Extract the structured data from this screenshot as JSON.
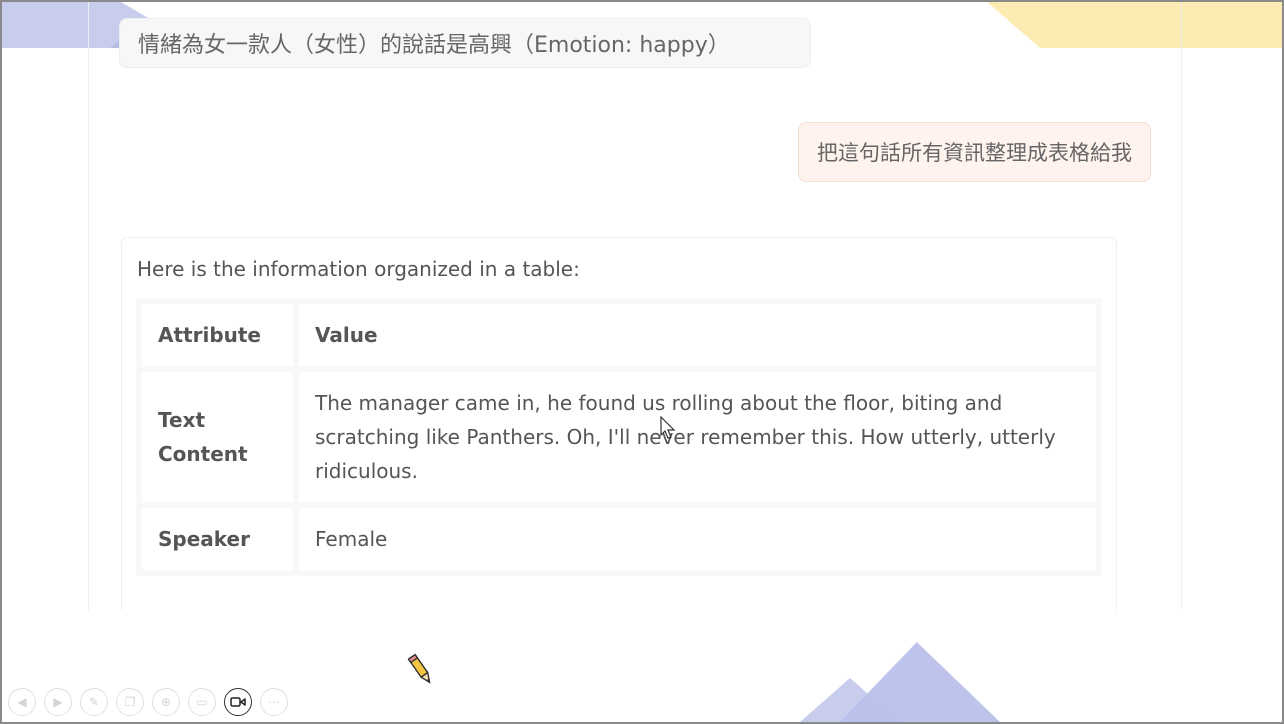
{
  "chat": {
    "previous_message_fragment": "情緒為女一款人（女性）的說話是高興（Emotion: happy）",
    "user_message": "把這句話所有資訊整理成表格給我",
    "assistant": {
      "intro": "Here is the information organized in a table:",
      "table": {
        "header": {
          "key": "Attribute",
          "value": "Value"
        },
        "rows": [
          {
            "key": "Text Content",
            "value": "The manager came in, he found us rolling about the floor, biting and scratching like Panthers. Oh, I'll never remember this. How utterly, utterly ridiculous."
          },
          {
            "key": "Speaker",
            "value": "Female"
          }
        ]
      }
    }
  },
  "toolbar": {
    "buttons": [
      {
        "name": "prev-slide-button",
        "icon": "arrow-left-icon",
        "glyph": "◀"
      },
      {
        "name": "next-slide-button",
        "icon": "arrow-right-icon",
        "glyph": "▶"
      },
      {
        "name": "pen-button",
        "icon": "pen-icon",
        "glyph": "✎"
      },
      {
        "name": "slides-button",
        "icon": "slides-icon",
        "glyph": "❐"
      },
      {
        "name": "zoom-button",
        "icon": "magnifier-icon",
        "glyph": "⊕"
      },
      {
        "name": "subtitles-button",
        "icon": "subtitles-icon",
        "glyph": "▭"
      },
      {
        "name": "camera-button",
        "icon": "video-camera-icon",
        "glyph": "▭◃",
        "active": true
      },
      {
        "name": "more-button",
        "icon": "more-icon",
        "glyph": "⋯"
      }
    ]
  },
  "colors": {
    "user_bubble_bg": "#fff3ee",
    "deco_blue": "#c8cdee",
    "deco_yellow": "#fcecb4"
  }
}
